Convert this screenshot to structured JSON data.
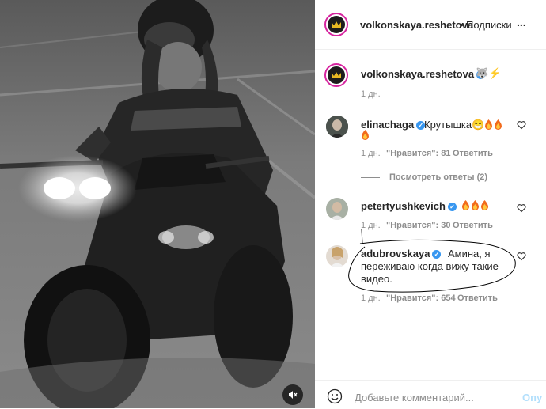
{
  "post": {
    "author": "volkonskaya.reshetova",
    "follow_label": "Подписки",
    "dot": "•",
    "more_label": "...",
    "caption_emoji": "🐺⚡",
    "time": "1 дн."
  },
  "comments": [
    {
      "username": "elinachaga",
      "text": "Крутышка😁",
      "flames": 3,
      "time": "1 дн.",
      "likes_label": "\"Нравится\": 81",
      "reply_label": "Ответить",
      "view_replies": "Посмотреть ответы (2)"
    },
    {
      "username": "petertyushkevich",
      "text": "",
      "flames": 3,
      "time": "1 дн.",
      "likes_label": "\"Нравится\": 30",
      "reply_label": "Ответить"
    },
    {
      "username": "adubrovskaya",
      "text_line1": "Амина, я",
      "text_line2": "переживаю когда вижу такие",
      "text_line3": "видео.",
      "time": "1 дн.",
      "likes_label": "\"Нравится\": 654",
      "reply_label": "Ответить"
    }
  ],
  "footer": {
    "placeholder": "Добавьте комментарий...",
    "post_label": "Опу"
  },
  "colors": {
    "flame": "#f26b1d",
    "verified": "#3897f0",
    "ring": "#d6249f"
  }
}
